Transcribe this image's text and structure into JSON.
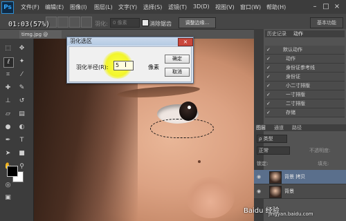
{
  "app": {
    "logo": "Ps",
    "zoom_overlay": "01:03(57%)"
  },
  "menu": [
    "文件(F)",
    "编辑(E)",
    "图像(I)",
    "图层(L)",
    "文字(Y)",
    "选择(S)",
    "滤镜(T)",
    "3D(D)",
    "视图(V)",
    "窗口(W)",
    "帮助(H)"
  ],
  "options_bar": {
    "feather_label": "羽化:",
    "feather_value": "0 像素",
    "antialias_label": "消除锯齿",
    "refine_edge_label": "调整边缘...",
    "workspace_label": "基本功能"
  },
  "document_tab": "timg.jpg @",
  "dialog": {
    "title": "羽化选区",
    "close": "×",
    "radius_label": "羽化半径(R):",
    "radius_value": "5",
    "unit_label": "像素",
    "ok_label": "确定",
    "cancel_label": "取消"
  },
  "history_panel": {
    "tabs": [
      "历史记录",
      "动作"
    ],
    "actions": [
      {
        "label": "默认动作",
        "checked": true
      },
      {
        "label": "动作",
        "checked": true
      },
      {
        "label": "身份证参考线",
        "checked": true
      },
      {
        "label": "身份证",
        "checked": true
      },
      {
        "label": "小二寸排版",
        "checked": true
      },
      {
        "label": "一寸排版",
        "checked": true
      },
      {
        "label": "二寸排版",
        "checked": true
      },
      {
        "label": "存储",
        "checked": true
      }
    ]
  },
  "layers_panel": {
    "tabs": [
      "图层",
      "通道",
      "路径"
    ],
    "filter_label": "ρ 类型",
    "blend_mode": "正常",
    "opacity_label": "不透明度:",
    "lock_label": "锁定:",
    "fill_label": "填充:",
    "layers": [
      {
        "name": "背景 拷贝"
      },
      {
        "name": "背景"
      }
    ]
  },
  "watermark": {
    "text": "Baidu 经验",
    "url": "jingyan.baidu.com"
  },
  "colors": {
    "foreground": "#000000",
    "background": "#ffffff"
  }
}
